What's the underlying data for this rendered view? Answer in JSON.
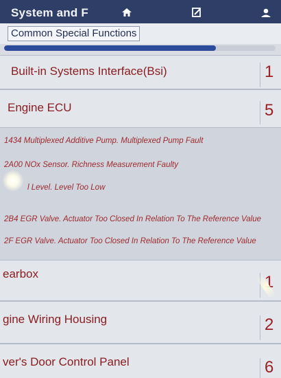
{
  "header": {
    "title": "System and F",
    "icons": [
      "home-icon",
      "report-icon",
      "user-icon"
    ]
  },
  "breadcrumb": "Common Special Functions",
  "progress": {
    "fraction": 0.78,
    "color": "#2d4b9b"
  },
  "rows": [
    {
      "label": "Built-in Systems Interface(Bsi)",
      "count": "1"
    },
    {
      "label": "Engine ECU",
      "count": "5"
    }
  ],
  "faults": [
    "1434 Multiplexed Additive Pump. Multiplexed Pump Fault",
    "2A00 NOx Sensor. Richness Measurement Faulty",
    "l Level. Level Too Low",
    "2B4 EGR Valve. Actuator Too Closed In Relation To The Reference Value",
    "2F EGR Valve. Actuator Too Closed In Relation To The Reference Value"
  ],
  "lower_rows": [
    {
      "label": "earbox",
      "count": "1"
    },
    {
      "label": "gine Wiring Housing",
      "count": "2"
    },
    {
      "label": "ver's Door Control Panel",
      "count": "6"
    }
  ],
  "colors": {
    "header": "#2f3e66",
    "text_red": "#8a1e22",
    "row_bg": "#e3e6eb"
  }
}
